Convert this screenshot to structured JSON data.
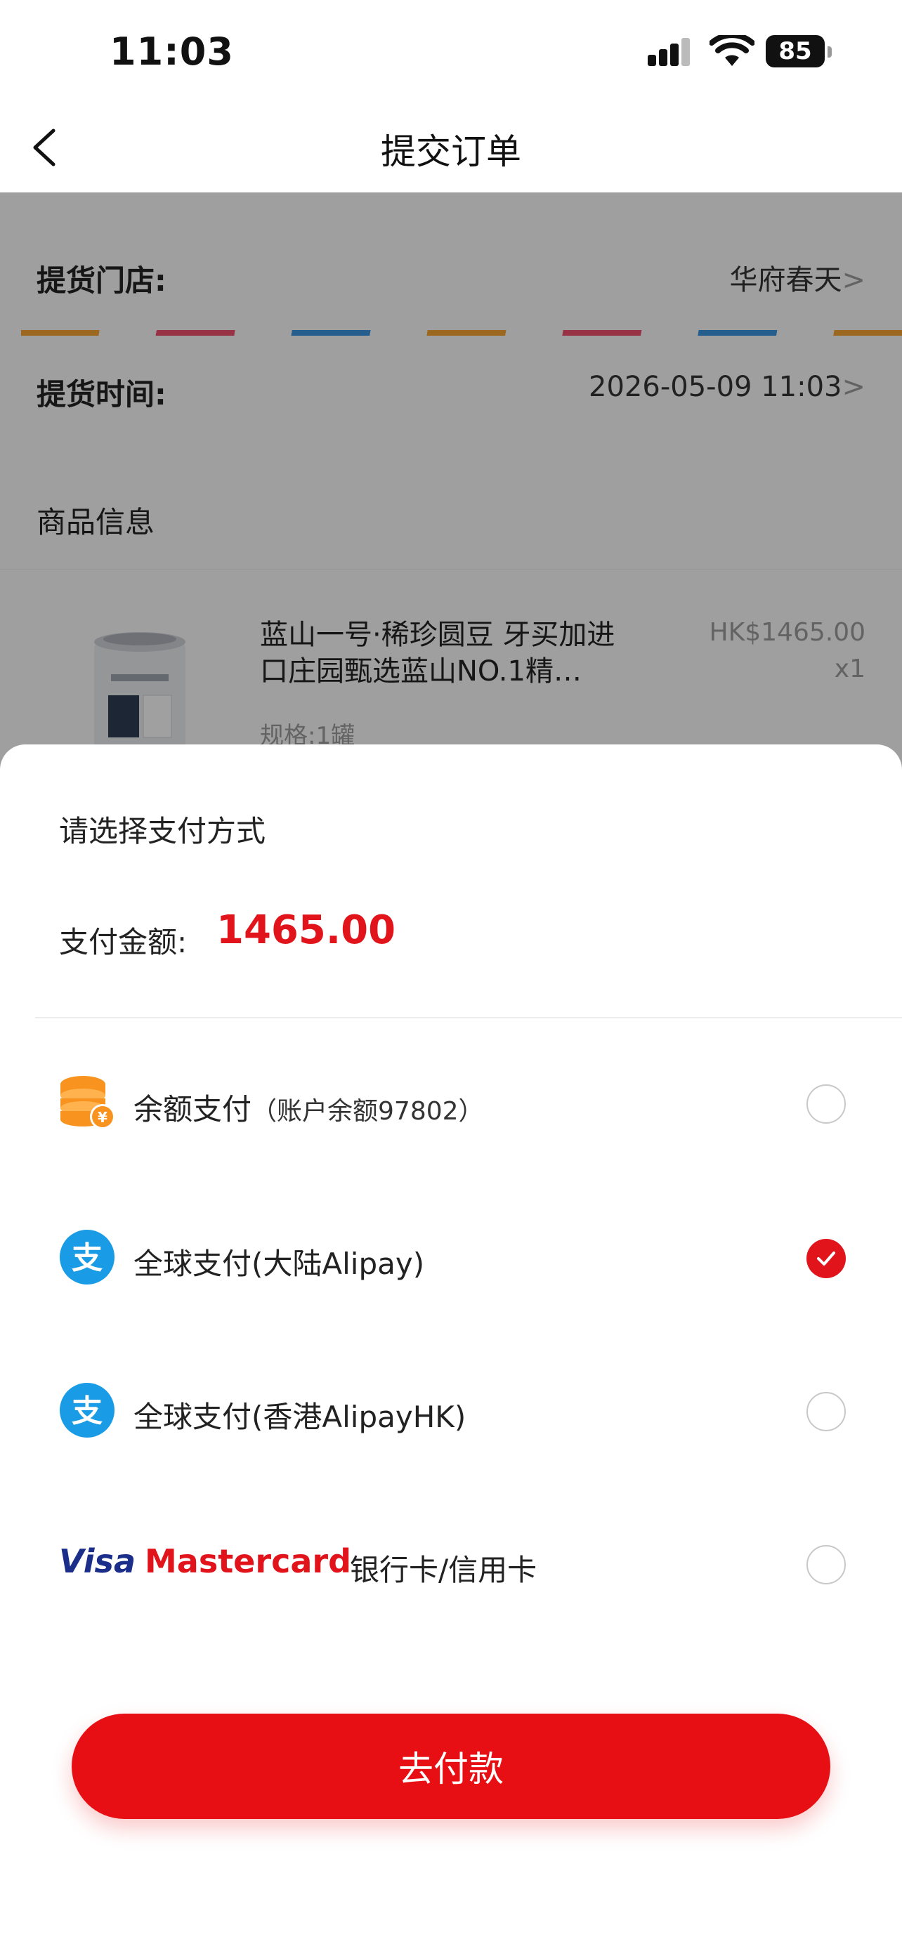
{
  "status_bar": {
    "time": "11:03",
    "battery": "85"
  },
  "nav": {
    "title": "提交订单"
  },
  "order": {
    "store_label": "提货门店:",
    "store_value": "华府春天",
    "time_label": "提货时间:",
    "time_value": "2026-05-09 11:03",
    "chevron": ">",
    "section_title": "商品信息"
  },
  "product": {
    "name": "蓝山一号·稀珍圆豆 牙买加进口庄园甄选蓝山NO.1精…",
    "spec": "规格:1罐",
    "price": "HK$1465.00",
    "qty": "x1"
  },
  "payment_sheet": {
    "title": "请选择支付方式",
    "amount_label": "支付金额:",
    "amount_value": "1465.00",
    "options": [
      {
        "label": "余额支付",
        "sub": "（账户余额97802）",
        "icon": "balance-coins-icon",
        "selected": false
      },
      {
        "label": "全球支付(大陆Alipay)",
        "sub": "",
        "icon": "alipay-icon",
        "selected": true
      },
      {
        "label": "全球支付(香港AlipayHK)",
        "sub": "",
        "icon": "alipay-hk-icon",
        "selected": false
      },
      {
        "label": "银行卡/信用卡",
        "visa": "Visa",
        "mastercard": "Mastercard",
        "selected": false
      }
    ],
    "pay_button": "去付款"
  },
  "colors": {
    "accent": "#e2141b",
    "alipay": "#1a9be6",
    "coin": "#f7931e",
    "visa": "#1a2e8a"
  }
}
